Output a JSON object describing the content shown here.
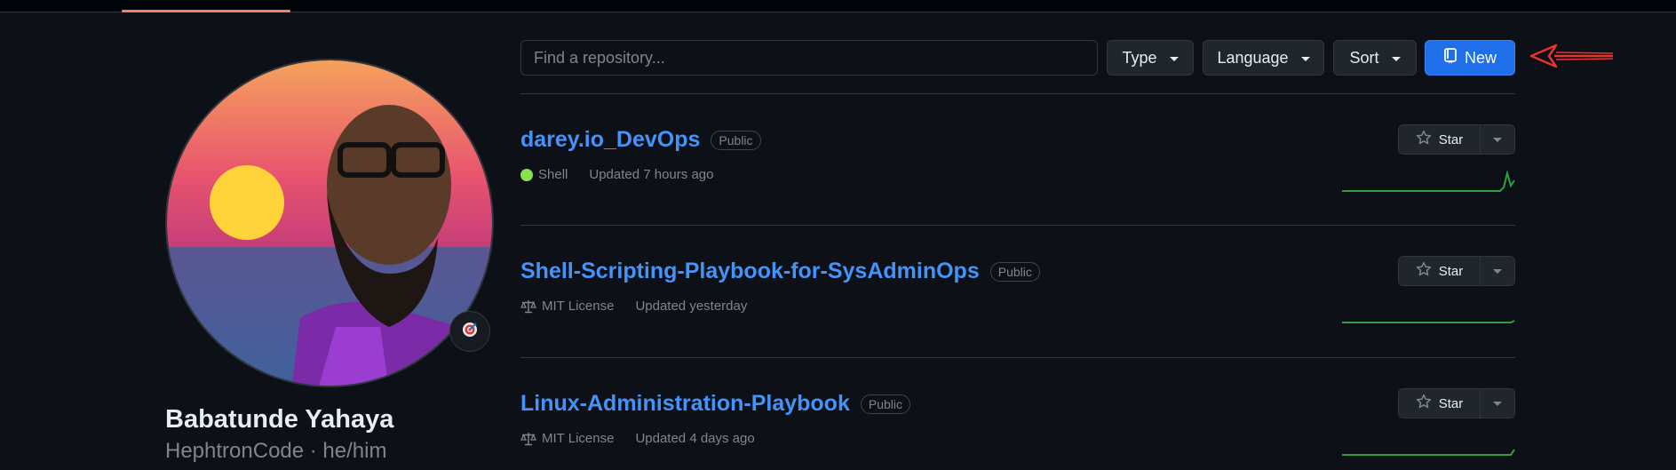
{
  "search": {
    "placeholder": "Find a repository..."
  },
  "filters": {
    "type_label": "Type",
    "language_label": "Language",
    "sort_label": "Sort"
  },
  "new_button": {
    "label": "New"
  },
  "profile": {
    "name": "Babatunde Yahaya",
    "login_line": "HephtronCode · he/him"
  },
  "repos": [
    {
      "name": "darey.io_DevOps",
      "visibility": "Public",
      "language": "Shell",
      "language_color": "#89e051",
      "updated": "Updated 7 hours ago",
      "star_label": "Star"
    },
    {
      "name": "Shell-Scripting-Playbook-for-SysAdminOps",
      "visibility": "Public",
      "license": "MIT License",
      "updated": "Updated yesterday",
      "star_label": "Star"
    },
    {
      "name": "Linux-Administration-Playbook",
      "visibility": "Public",
      "license": "MIT License",
      "updated": "Updated 4 days ago",
      "star_label": "Star"
    }
  ],
  "colors": {
    "accent": "#1f6feb",
    "link": "#4493f8",
    "annotation_arrow": "#e5342c",
    "spark_green": "#2ea043"
  },
  "icons": [
    "repo-icon",
    "star-icon",
    "law-icon",
    "target-emoji-icon",
    "caret-down-icon",
    "red-arrow-annotation"
  ]
}
